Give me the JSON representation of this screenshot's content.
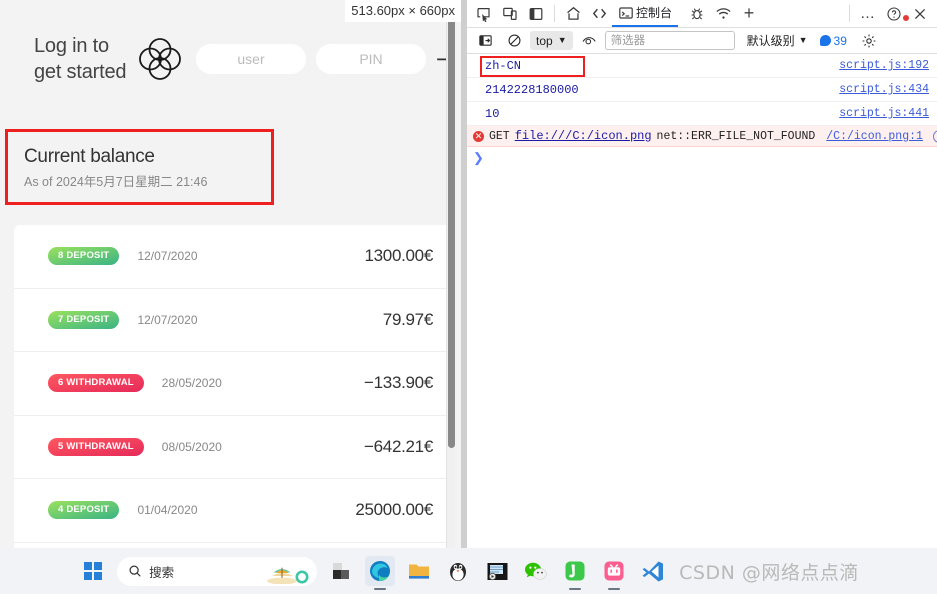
{
  "overlay": {
    "size_tooltip": "513.60px × 660px"
  },
  "page": {
    "nav": {
      "welcome": "Log in to get started",
      "logo_icon": "quatrefoil-logo-icon",
      "user_placeholder": "user",
      "user_value": "",
      "pin_placeholder": "PIN",
      "pin_value": "",
      "submit_label": "→"
    },
    "balance": {
      "label": "Current balance",
      "date_prefix": "As of ",
      "date": "As of 2024年5月7日星期二 21:46",
      "annotation_color": "#ef1f1f"
    },
    "movements": [
      {
        "index": "8",
        "type": "DEPOSIT",
        "badge": "8 DEPOSIT",
        "date": "12/07/2020",
        "value": "1300.00€",
        "kind": "deposit"
      },
      {
        "index": "7",
        "type": "DEPOSIT",
        "badge": "7 DEPOSIT",
        "date": "12/07/2020",
        "value": "79.97€",
        "kind": "deposit"
      },
      {
        "index": "6",
        "type": "WITHDRAWAL",
        "badge": "6 WITHDRAWAL",
        "date": "28/05/2020",
        "value": "−133.90€",
        "kind": "withdrawal"
      },
      {
        "index": "5",
        "type": "WITHDRAWAL",
        "badge": "5 WITHDRAWAL",
        "date": "08/05/2020",
        "value": "−642.21€",
        "kind": "withdrawal"
      },
      {
        "index": "4",
        "type": "DEPOSIT",
        "badge": "4 DEPOSIT",
        "date": "01/04/2020",
        "value": "25000.00€",
        "kind": "deposit"
      }
    ],
    "colors": {
      "deposit_from": "#39b385",
      "deposit_to": "#9be15d",
      "withdrawal_from": "#e52a5a",
      "withdrawal_to": "#ff585f",
      "page_bg": "#f3f3f3"
    }
  },
  "devtools": {
    "tabs": [
      {
        "label": "控制台",
        "icon": "console-icon",
        "active": true
      }
    ],
    "left_icons": [
      "inspect-element-icon",
      "device-toolbar-icon",
      "dock-side-icon"
    ],
    "nav_icons": [
      "home-icon",
      "elements-code-icon"
    ],
    "right_icons": [
      "bug-icon",
      "network-conditions-icon",
      "more-tabs-plus-icon",
      "more-options-icon",
      "help-icon",
      "close-icon"
    ],
    "plus_label": "+",
    "more_label": "…",
    "help_label": "?",
    "close_label": "✕",
    "toolbar": {
      "sidebar_icon": "console-sidebar-icon",
      "clear_icon": "clear-console-icon",
      "context": "top",
      "eye_icon": "live-expression-icon",
      "filter_placeholder": "筛选器",
      "filter_value": "",
      "level": "默认级别",
      "issues_count": "39",
      "settings_icon": "gear-icon"
    },
    "console_rows": [
      {
        "message": "zh-CN",
        "source": "script.js:192",
        "level": "log",
        "annotated": true
      },
      {
        "message": "2142228180000",
        "source": "script.js:434",
        "level": "log",
        "annotated": false
      },
      {
        "message": "10",
        "source": "script.js:441",
        "level": "log",
        "annotated": false
      }
    ],
    "error_row": {
      "method": "GET",
      "url": "file:///C:/icon.png",
      "status": "net::ERR_FILE_NOT_FOUND",
      "source": "/C:/icon.png:1",
      "badge1": "(i)",
      "badge2": "(#)"
    },
    "prompt": "❯"
  },
  "taskbar": {
    "start_label": "start-menu",
    "search_placeholder": "搜索",
    "search_icon": "search-icon",
    "items": [
      {
        "name": "taskview-icon",
        "label": "task-view"
      },
      {
        "name": "edge-icon",
        "label": "Microsoft Edge"
      },
      {
        "name": "file-explorer-icon",
        "label": "File Explorer"
      },
      {
        "name": "qq-icon",
        "label": "QQ"
      },
      {
        "name": "media-player-icon",
        "label": "Media Player"
      },
      {
        "name": "wechat-icon",
        "label": "WeChat"
      },
      {
        "name": "navicat-icon",
        "label": "Navicat"
      },
      {
        "name": "bilibili-icon",
        "label": "Bilibili"
      },
      {
        "name": "vscode-icon",
        "label": "Visual Studio Code"
      }
    ],
    "watermark": "CSDN @网络点点滴"
  }
}
